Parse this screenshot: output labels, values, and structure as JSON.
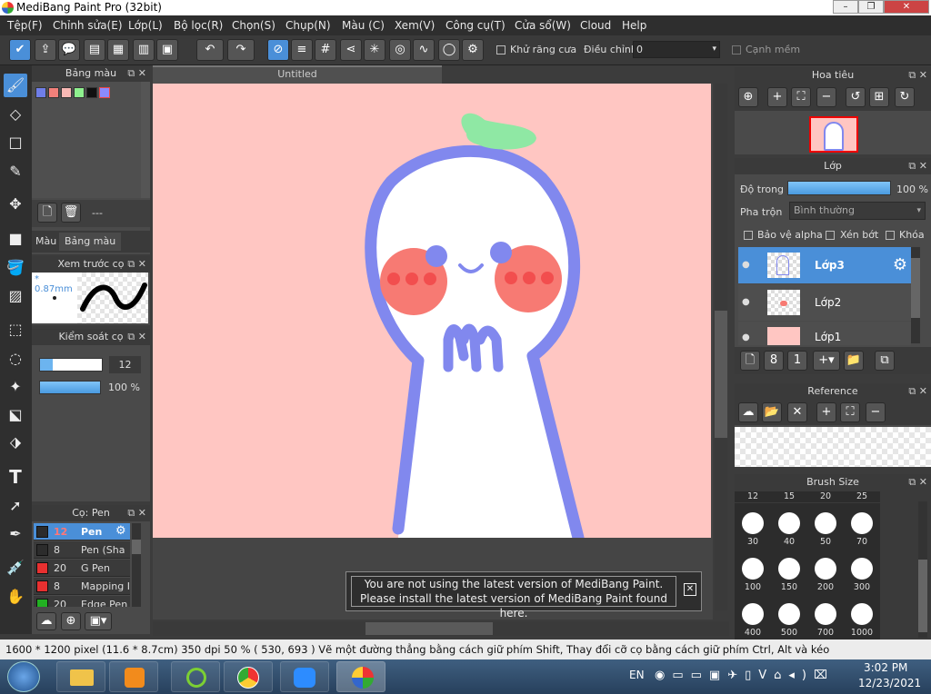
{
  "window": {
    "title": "MediBang Paint Pro (32bit)"
  },
  "menu": [
    "Tệp(F)",
    "Chỉnh sửa(E)",
    "Lớp(L)",
    "Bộ lọc(R)",
    "Chọn(S)",
    "Chụp(N)",
    "Màu (C)",
    "Xem(V)",
    "Công cụ(T)",
    "Cửa sổ(W)",
    "Cloud",
    "Help"
  ],
  "toolbar": {
    "antialias_label": "Khử răng cưa",
    "adjust_label": "Điều chỉnh",
    "adjust_value": "0",
    "smooth_label": "Cạnh mềm"
  },
  "color_panel": {
    "title": "Bảng màu",
    "dash": "---",
    "tab_color": "Màu",
    "tab_palette": "Bảng màu",
    "swatches": [
      "#6f7ee8",
      "#f2807a",
      "#f8b8b4",
      "#8ef08e",
      "#101010",
      "#8a8aff"
    ]
  },
  "preview_panel": {
    "title": "Xem trước cọ",
    "size": "* 0.87mm"
  },
  "brush_control": {
    "title": "Kiểm soát cọ",
    "size_value": "12",
    "opacity_value": "100 %"
  },
  "brush_list": {
    "title": "Cọ: Pen",
    "items": [
      {
        "size": "12",
        "name": "Pen",
        "color": "#2c2c2c"
      },
      {
        "size": "8",
        "name": "Pen (Sha",
        "color": "#2c2c2c"
      },
      {
        "size": "20",
        "name": "G Pen",
        "color": "#e83030"
      },
      {
        "size": "8",
        "name": "Mapping I",
        "color": "#e83030"
      },
      {
        "size": "20",
        "name": "Edge Pen",
        "color": "#22b022"
      }
    ]
  },
  "document": {
    "tab": "Untitled"
  },
  "notice": {
    "line1": "You are not using the latest version of MediBang Paint.",
    "line2": "Please install the latest version of MediBang Paint found here."
  },
  "navigator": {
    "title": "Hoa tiêu"
  },
  "layers": {
    "title": "Lớp",
    "opacity_label": "Độ trong",
    "opacity_value": "100 %",
    "blend_label": "Pha trộn",
    "blend_value": "Bình thường",
    "alpha_label": "Bảo vệ alpha",
    "clip_label": "Xén bớt",
    "lock_label": "Khóa",
    "items": [
      "Lớp3",
      "Lớp2",
      "Lớp1"
    ]
  },
  "reference": {
    "title": "Reference"
  },
  "brush_size": {
    "title": "Brush Size",
    "top_row": [
      "12",
      "15",
      "20",
      "25"
    ],
    "sizes": [
      "30",
      "40",
      "50",
      "70",
      "100",
      "150",
      "200",
      "300",
      "400",
      "500",
      "700",
      "1000"
    ]
  },
  "status": {
    "text": "1600 * 1200 pixel   (11.6 * 8.7cm)   350 dpi   50 %   ( 530, 693 )   Vẽ một đường thẳng bằng cách giữ phím Shift, Thay đổi cỡ cọ bằng cách giữ phím Ctrl, Alt và kéo"
  },
  "taskbar": {
    "lang": "EN",
    "time": "3:02 PM",
    "date": "12/23/2021"
  }
}
